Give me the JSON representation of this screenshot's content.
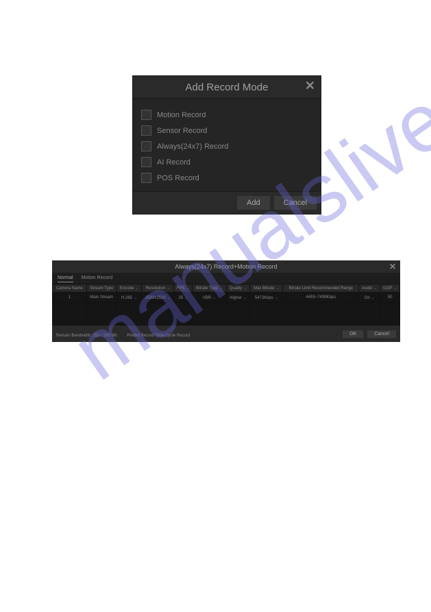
{
  "watermark": "manualslive.com",
  "dialog1": {
    "title": "Add Record Mode",
    "options": [
      "Motion Record",
      "Sensor Record",
      "Always(24x7) Record",
      "AI Record",
      "POS Record"
    ],
    "add_btn": "Add",
    "cancel_btn": "Cancel"
  },
  "dialog2": {
    "title": "Always(24x7) Record+Motion Record",
    "tabs": {
      "normal": "Normal",
      "motion": "Motion Record"
    },
    "headers": {
      "camera_name": "Camera Name",
      "stream_type": "Stream Type",
      "encode": "Encode",
      "resolution": "Resolution",
      "fps": "FPS",
      "bitrate_type": "Bitrate Type",
      "quality": "Quality",
      "max_bitrate": "Max Bitrate",
      "bitrate_limit": "Bitrate Limit Recommended Range",
      "audio": "Audio",
      "gop": "GOP"
    },
    "row1": {
      "camera_name": "1",
      "stream_type": "Main Stream",
      "encode": "H.265",
      "resolution": "2592x1520",
      "fps": "25",
      "bitrate_type": "VBR",
      "quality": "Higher",
      "max_bitrate": "5472Kbps",
      "bitrate_limit": "4459~7499Kbps",
      "audio": "On",
      "gop": "50"
    },
    "footer": {
      "bandwidth": "Remain Bandwidth: 332 / 256 Mb",
      "predict": "Predict Record Time Cycle Record",
      "ok_btn": "OK",
      "cancel_btn": "Cancel"
    }
  }
}
